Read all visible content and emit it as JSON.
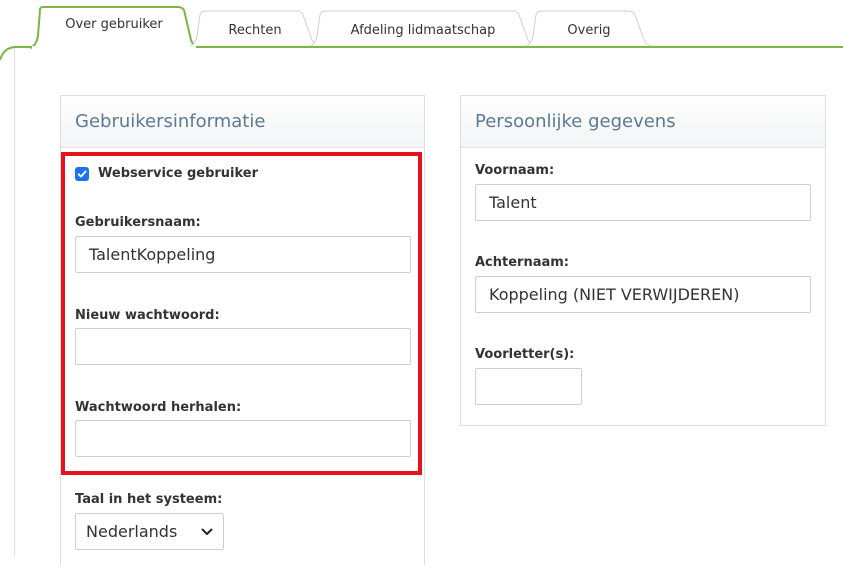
{
  "tabs": [
    {
      "label": "Over gebruiker",
      "active": true
    },
    {
      "label": "Rechten",
      "active": false
    },
    {
      "label": "Afdeling lidmaatschap",
      "active": false
    },
    {
      "label": "Overig",
      "active": false
    }
  ],
  "user_info": {
    "title": "Gebruikersinformatie",
    "webservice_label": "Webservice gebruiker",
    "webservice_checked": true,
    "username_label": "Gebruikersnaam:",
    "username_value": "TalentKoppeling",
    "new_password_label": "Nieuw wachtwoord:",
    "new_password_value": "",
    "repeat_password_label": "Wachtwoord herhalen:",
    "repeat_password_value": "",
    "language_label": "Taal in het systeem:",
    "language_value": "Nederlands"
  },
  "personal": {
    "title": "Persoonlijke gegevens",
    "first_name_label": "Voornaam:",
    "first_name_value": "Talent",
    "last_name_label": "Achternaam:",
    "last_name_value": "Koppeling (NIET VERWIJDEREN)",
    "initials_label": "Voorletter(s):",
    "initials_value": ""
  },
  "colors": {
    "accent_green": "#7ab648",
    "highlight_red": "#e3141e",
    "panel_title": "#5b7b93",
    "checkbox_blue": "#1a73e8"
  }
}
